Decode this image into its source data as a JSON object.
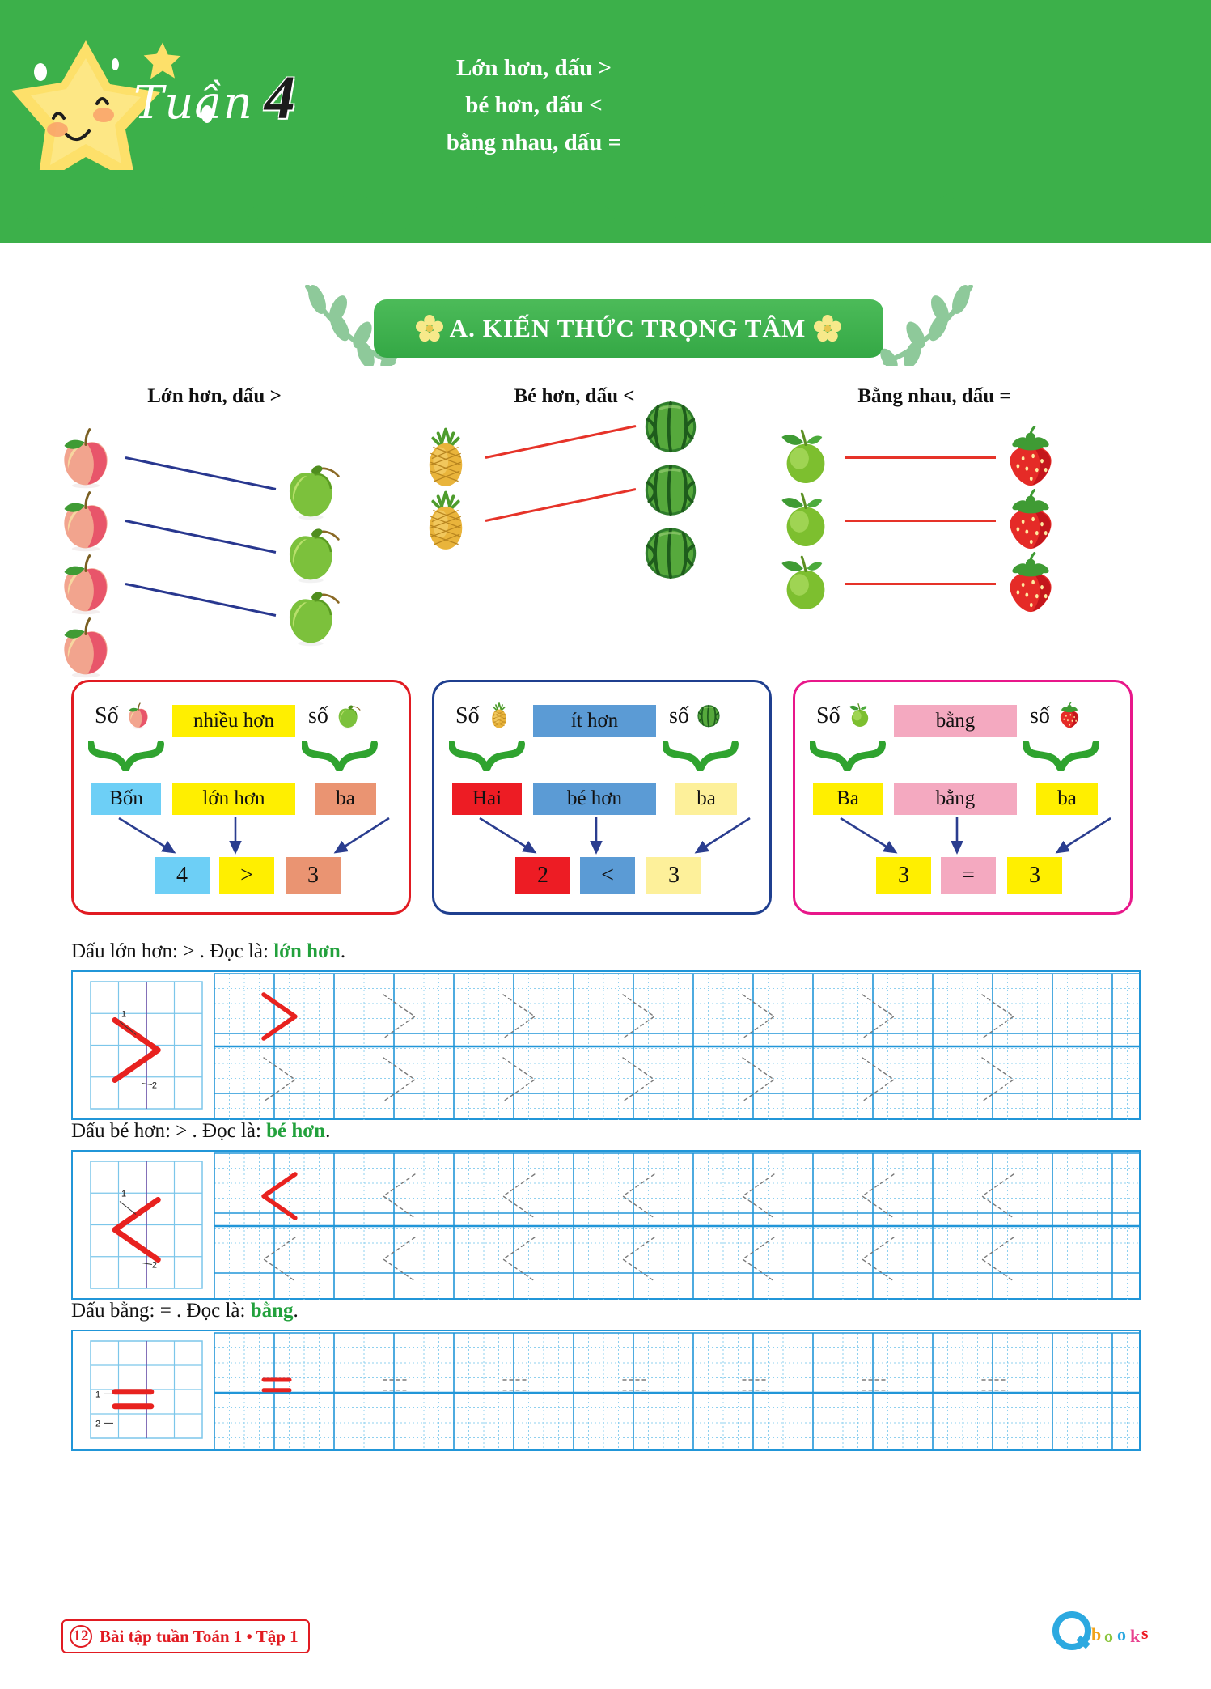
{
  "header": {
    "week_word": "Tuần",
    "week_number": "4",
    "title_lines": [
      "Lớn hơn, dấu >",
      "bé hơn, dấu <",
      "bằng nhau, dấu ="
    ],
    "bg_color": "#3cb04a",
    "star_color": "#fde06a"
  },
  "section": {
    "banner_title": "A. KIẾN THỨC TRỌNG TÂM",
    "flower_color": "#f7e98a",
    "leaf_color": "#8ec99a"
  },
  "compare": [
    {
      "heading": "Lớn hơn, dấu >",
      "left_fruit": "apple",
      "left_count": 4,
      "right_fruit": "green-apple",
      "right_count": 3,
      "line_color": "#28378f"
    },
    {
      "heading": "Bé hơn, dấu <",
      "left_fruit": "pineapple",
      "left_count": 2,
      "right_fruit": "watermelon",
      "right_count": 3,
      "line_color": "#e63329"
    },
    {
      "heading": "Bằng nhau, dấu =",
      "left_fruit": "lime",
      "left_count": 3,
      "right_fruit": "strawberry",
      "right_count": 3,
      "line_color": "#e63329"
    }
  ],
  "rule_boxes": [
    {
      "border_color": "#e11b22",
      "left_word": "Số",
      "left_fruit": "apple",
      "relation_word": "nhiều hơn",
      "relation_bg": "#ffef00",
      "right_word": "số",
      "right_fruit": "green-apple",
      "left_name": "Bốn",
      "left_name_bg": "#6dcff6",
      "relation2": "lớn hơn",
      "relation2_bg": "#ffef00",
      "right_name": "ba",
      "right_name_bg": "#ea9472",
      "left_value": "4",
      "left_value_bg": "#6dcff6",
      "symbol": ">",
      "symbol_bg": "#ffef00",
      "right_value": "3",
      "right_value_bg": "#ea9472",
      "arrow_color": "#2a3d8f"
    },
    {
      "border_color": "#1f3f8f",
      "left_word": "Số",
      "left_fruit": "pineapple",
      "relation_word": "ít hơn",
      "relation_bg": "#5b9bd5",
      "right_word": "số",
      "right_fruit": "watermelon",
      "left_name": "Hai",
      "left_name_bg": "#ed1c24",
      "relation2": "bé hơn",
      "relation2_bg": "#5b9bd5",
      "right_name": "ba",
      "right_name_bg": "#fdf09a",
      "left_value": "2",
      "left_value_bg": "#ed1c24",
      "symbol": "<",
      "symbol_bg": "#5b9bd5",
      "right_value": "3",
      "right_value_bg": "#fdf09a",
      "arrow_color": "#2a3d8f"
    },
    {
      "border_color": "#e8178a",
      "left_word": "Số",
      "left_fruit": "lime",
      "relation_word": "bằng",
      "relation_bg": "#f4a9c0",
      "right_word": "số",
      "right_fruit": "strawberry",
      "left_name": "Ba",
      "left_name_bg": "#ffef00",
      "relation2": "bằng",
      "relation2_bg": "#f4a9c0",
      "right_name": "ba",
      "right_name_bg": "#ffef00",
      "left_value": "3",
      "left_value_bg": "#ffef00",
      "symbol": "=",
      "symbol_bg": "#f4a9c0",
      "right_value": "3",
      "right_value_bg": "#ffef00",
      "arrow_color": "#2a3d8f"
    }
  ],
  "practice": [
    {
      "label_prefix": "Dấu lớn hơn: > . Đọc là: ",
      "label_highlight": "lớn hơn",
      "label_suffix": ".",
      "glyph": ">",
      "highlight_color": "#22a13c",
      "stroke_labels": [
        "1",
        "2"
      ],
      "model_rows": 2,
      "ghost_per_row": 6
    },
    {
      "label_prefix": "Dấu bé hơn: > . Đọc là: ",
      "label_highlight": "bé hơn",
      "label_suffix": ".",
      "glyph": "<",
      "highlight_color": "#22a13c",
      "stroke_labels": [
        "1",
        "2"
      ],
      "model_rows": 2,
      "ghost_per_row": 6
    },
    {
      "label_prefix": "Dấu bằng: = . Đọc là: ",
      "label_highlight": "bằng",
      "label_suffix": ".",
      "glyph": "=",
      "highlight_color": "#22a13c",
      "stroke_labels": [
        "1",
        "2"
      ],
      "model_rows": 1,
      "ghost_per_row": 6
    }
  ],
  "footer": {
    "page_number": "12",
    "text": "Bài tập tuần Toán 1 • Tập 1",
    "accent_color": "#e11b22",
    "logo_text": "Qbooks"
  }
}
